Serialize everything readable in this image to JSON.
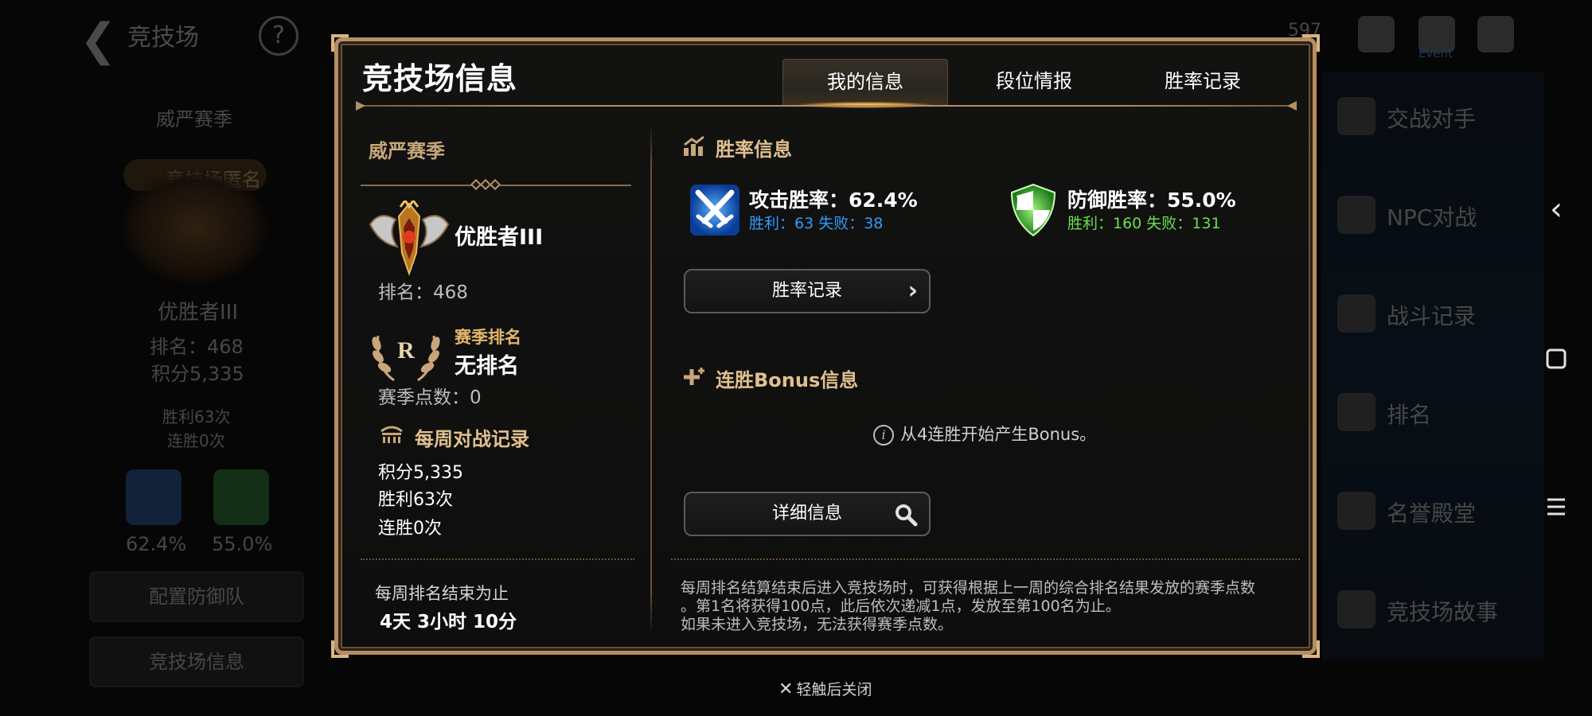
{
  "background": {
    "title": "竞技场",
    "help": "?",
    "season": "威严赛季",
    "badge": "竞技场匿名",
    "rank_name": "优胜者III",
    "rank": "排名：468",
    "score": "积分5,335",
    "wins": "胜利63次",
    "streak": "连胜0次",
    "attack_rate": "62.4%",
    "defense_rate": "55.0%",
    "config_button": "配置防御队",
    "arena_info_button": "竞技场信息",
    "resources": [
      "597"
    ],
    "event_label": "Event",
    "menu": [
      "交战对手",
      "NPC对战",
      "战斗记录",
      "排名",
      "名誉殿堂",
      "竞技场故事"
    ]
  },
  "modal": {
    "title": "竞技场信息",
    "tabs": [
      "我的信息",
      "段位情报",
      "胜率记录"
    ],
    "left": {
      "season_name": "威严赛季",
      "rank_name": "优胜者III",
      "rank_position": "排名：468",
      "season_rank_label": "赛季排名",
      "season_rank_value": "无排名",
      "season_points": "赛季点数：0",
      "weekly_title": "每周对战记录",
      "weekly_score": "积分5,335",
      "weekly_wins": "胜利63次",
      "weekly_streak": "连胜0次",
      "reset_label": "每周排名结束为止",
      "reset_value": "4天 3小时 10分"
    },
    "right": {
      "winrate_title": "胜率信息",
      "attack_label": "攻击胜率：62.4%",
      "attack_detail": "胜利：63 失败：38",
      "defense_label": "防御胜率：55.0%",
      "defense_detail": "胜利：160 失败：131",
      "winrate_button": "胜率记录",
      "bonus_title": "连胜Bonus信息",
      "bonus_info": "从4连胜开始产生Bonus。",
      "detail_button": "详细信息",
      "description": [
        "每周排名结算结束后进入竞技场时，可获得根据上一周的综合排名结果发放的赛季点数",
        "。第1名将获得100点，此后依次递减1点，发放至第100名为止。",
        "如果未进入竞技场，无法获得赛季点数。"
      ]
    },
    "close_hint": "轻触后关闭"
  },
  "colors": {
    "gold": "#b58e62",
    "title_gold": "#e0c08f",
    "attack_blue": "#2f9bff",
    "defense_green": "#69e04b"
  },
  "icons": [
    "back-arrow-icon",
    "help-icon",
    "chart-icon",
    "crossed-swords-icon",
    "shield-icon",
    "chevron-right-icon",
    "sparkle-icon",
    "info-icon",
    "search-icon",
    "laurel-icon",
    "colosseum-icon",
    "close-icon",
    "nav-back-icon",
    "nav-home-icon",
    "nav-menu-icon"
  ]
}
